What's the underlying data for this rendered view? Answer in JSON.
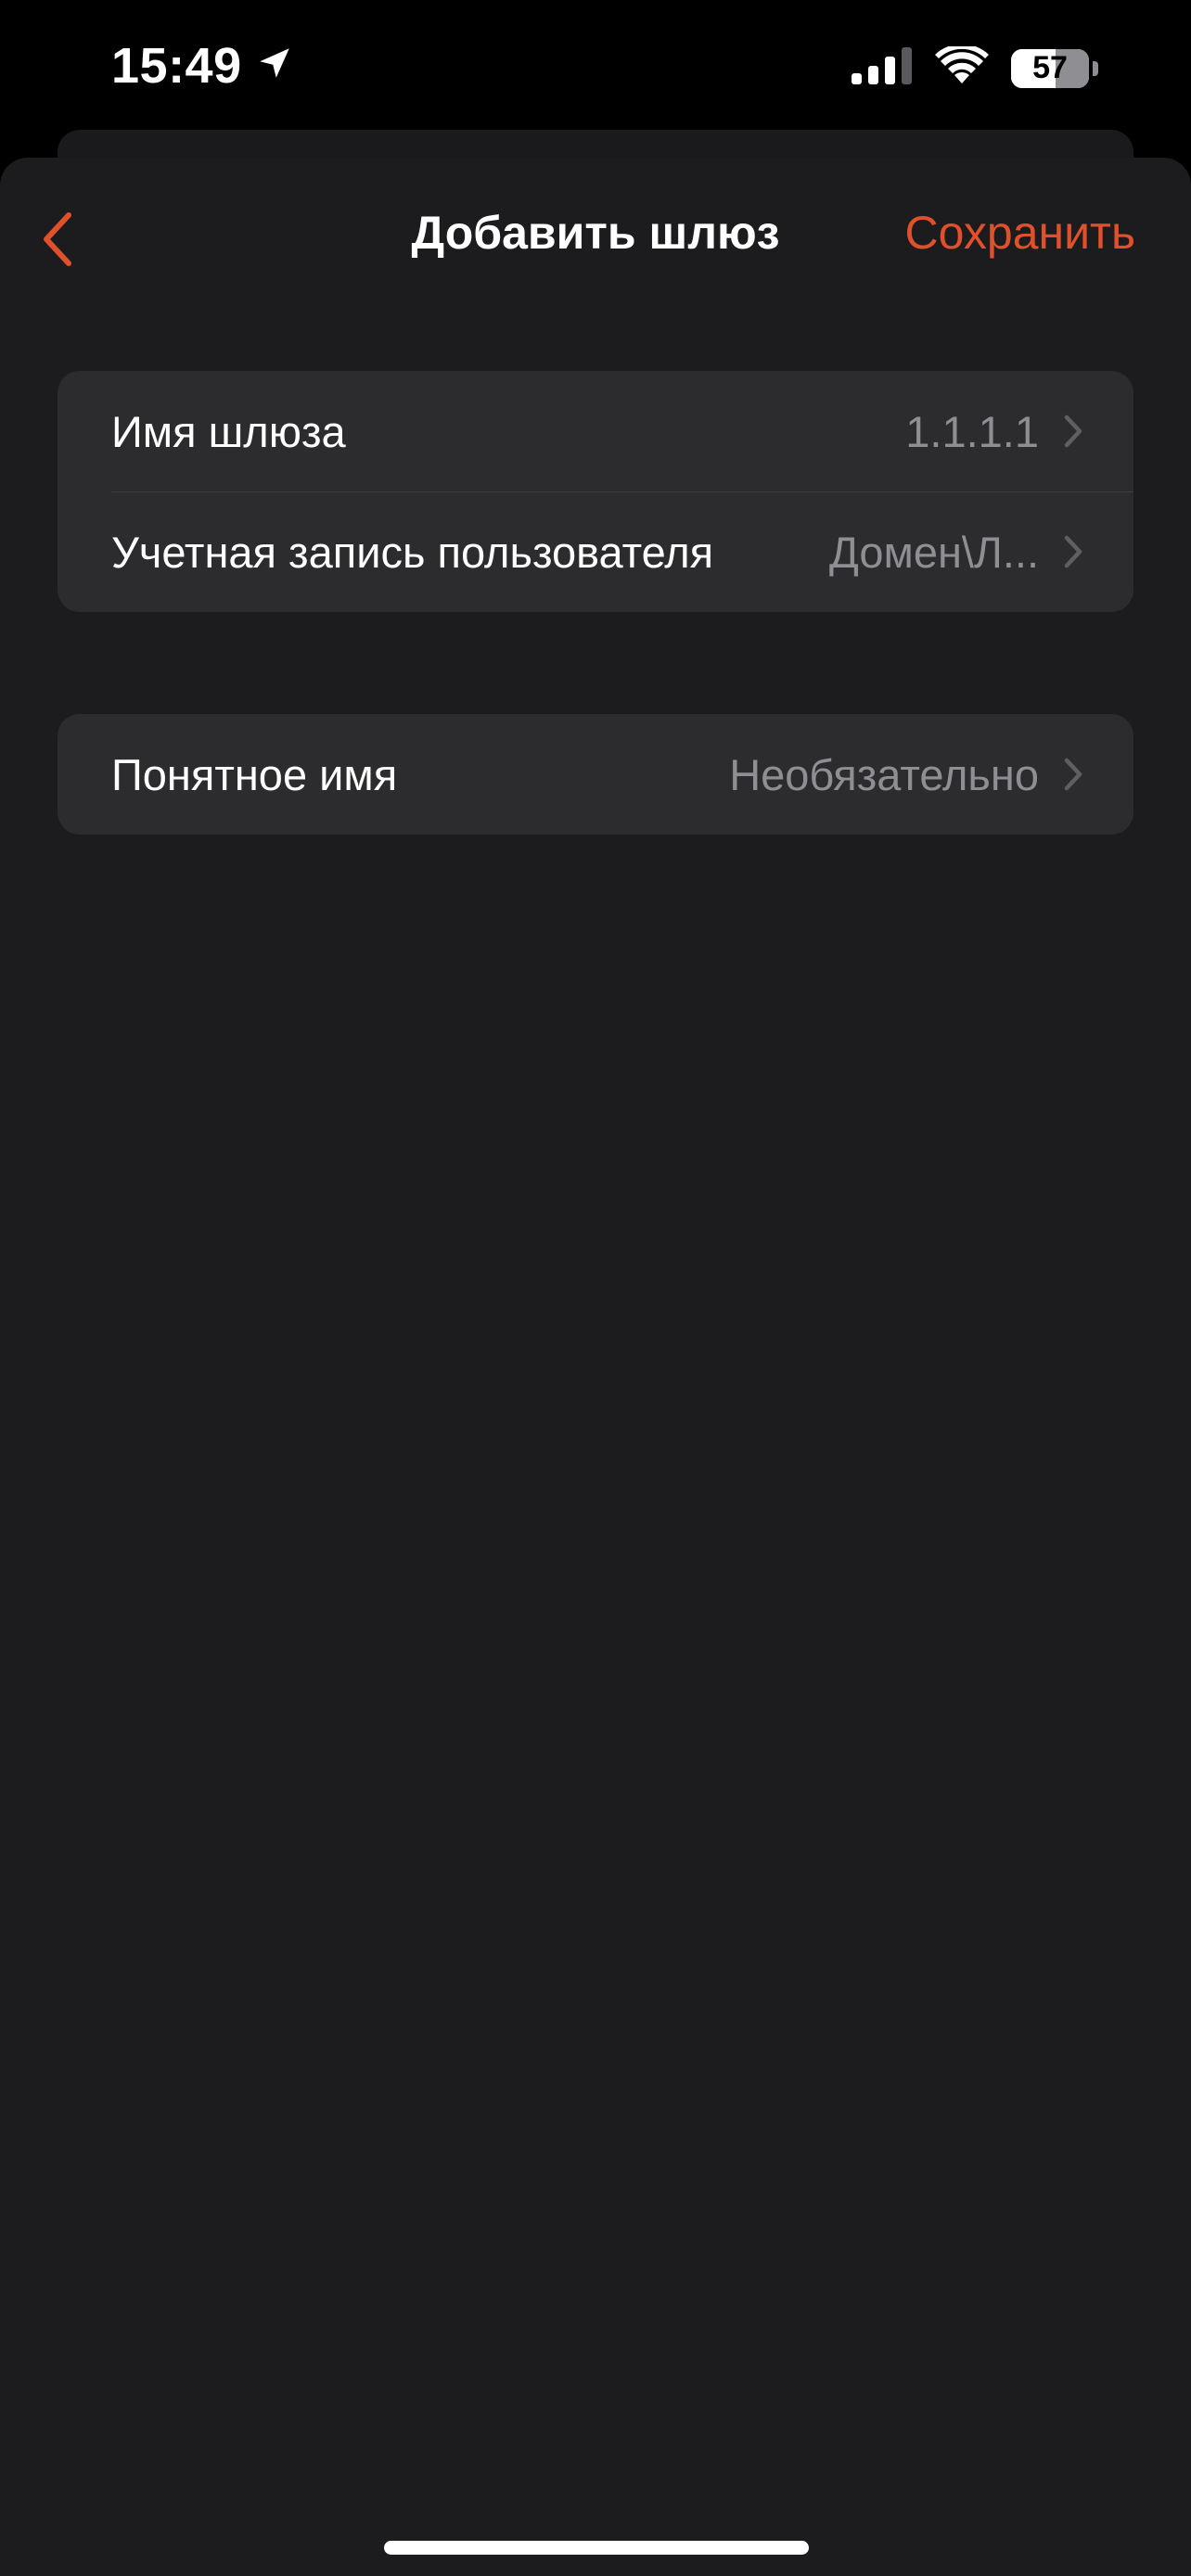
{
  "status_bar": {
    "time": "15:49",
    "battery_percent": "57",
    "battery_level": 0.57
  },
  "nav": {
    "title": "Добавить шлюз",
    "save_label": "Сохранить"
  },
  "colors": {
    "accent": "#e0512b",
    "background": "#1c1c1e",
    "cell": "#2c2c2e",
    "secondary_text": "#8e8e93"
  },
  "groups": [
    {
      "rows": [
        {
          "label": "Имя шлюза",
          "value": "1.1.1.1"
        },
        {
          "label": "Учетная запись пользователя",
          "value": "Домен\\Л..."
        }
      ]
    },
    {
      "rows": [
        {
          "label": "Понятное имя",
          "value": "Необязательно"
        }
      ]
    }
  ]
}
